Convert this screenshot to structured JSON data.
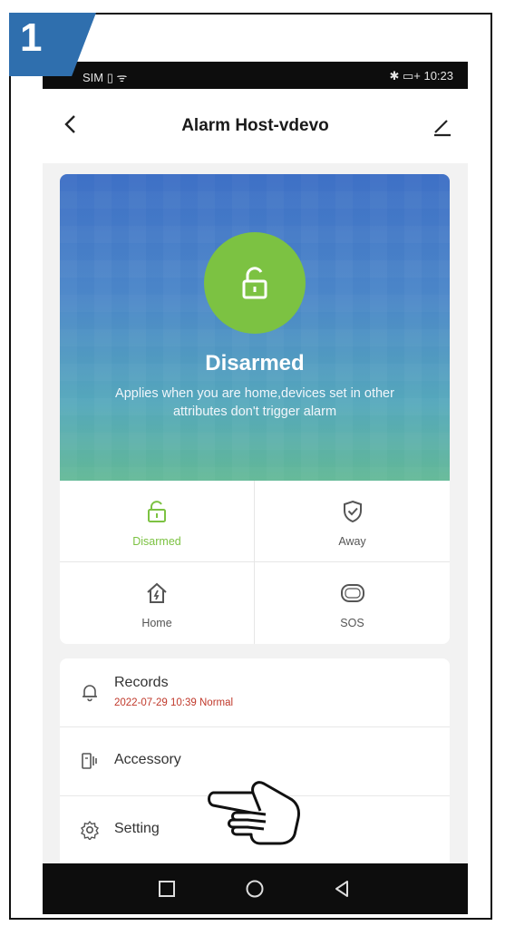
{
  "step": {
    "number": "1",
    "color": "#2f6fae"
  },
  "statusbar": {
    "left": "SIM ▯ ᯤ",
    "right": "✱ ▭+ 10:23"
  },
  "header": {
    "title": "Alarm Host-vdevo",
    "back_icon": "chevron-left-icon",
    "edit_icon": "pencil-icon"
  },
  "hero": {
    "state": "Disarmed",
    "description": "Applies when you are home,devices set in other attributes  don't trigger alarm",
    "accent": "#7cc242"
  },
  "modes": [
    {
      "label": "Disarmed",
      "icon": "unlock-icon"
    },
    {
      "label": "Away",
      "icon": "shield-check-icon"
    },
    {
      "label": "Home",
      "icon": "home-icon"
    },
    {
      "label": "SOS",
      "icon": "sos-icon"
    }
  ],
  "list": {
    "records": {
      "title": "Records",
      "subtitle": "2022-07-29 10:39 Normal",
      "icon": "bell-icon"
    },
    "accessory": {
      "title": "Accessory",
      "icon": "device-icon"
    },
    "setting": {
      "title": "Setting",
      "icon": "gear-icon"
    }
  }
}
